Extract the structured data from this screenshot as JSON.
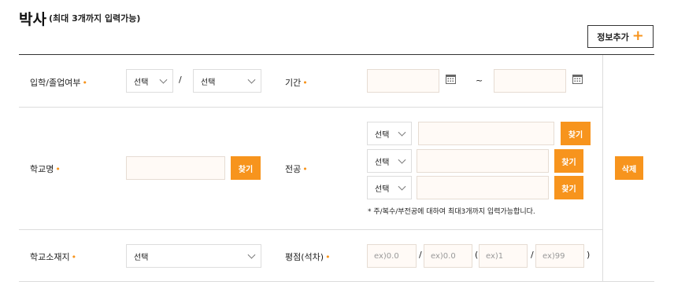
{
  "header": {
    "title": "박사",
    "subtitle": "(최대 3개까지 입력가능)",
    "add_button": "정보추가",
    "add_icon": "+"
  },
  "required_mark": "•",
  "row1": {
    "label": "입학/졸업여부",
    "select1": "선택",
    "slash": "/",
    "select2": "선택",
    "period_label": "기간",
    "tilde": "~"
  },
  "row2": {
    "label": "학교명",
    "find_button": "찾기",
    "major_label": "전공",
    "majors": [
      {
        "select": "선택",
        "find_button": "찾기"
      },
      {
        "select": "선택",
        "find_button": "찾기"
      },
      {
        "select": "선택",
        "find_button": "찾기"
      }
    ],
    "note": "* 주/복수/부전공에 대하여 최대3개까지 입력가능합니다.",
    "delete_button": "삭제"
  },
  "row3": {
    "label": "학교소재지",
    "select": "선택",
    "gpa_label": "평점(석차)",
    "gpa_placeholders": [
      "ex)0.0",
      "ex)0.0",
      "ex)1",
      "ex)99"
    ],
    "seps": [
      "/",
      "(",
      "/",
      ")"
    ]
  },
  "colors": {
    "accent": "#f7941d",
    "input_bg": "#fffaf6",
    "border": "#dcdcdc"
  },
  "icons": {
    "calendar": "calendar-icon",
    "chevron": "chevron-down-icon",
    "plus": "plus-icon"
  }
}
